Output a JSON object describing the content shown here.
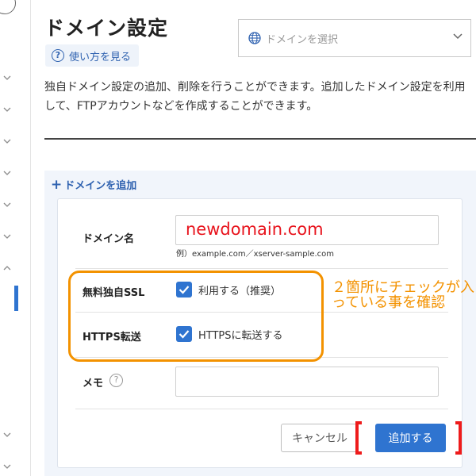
{
  "header": {
    "title": "ドメイン設定",
    "help_label": "使い方を見る",
    "domain_select_placeholder": "ドメインを選択"
  },
  "description": "独自ドメイン設定の追加、削除を行うことができます。追加したドメイン設定を利用して、FTPアカウントなどを作成することができます。",
  "add_panel": {
    "add_link_label": "ドメインを追加",
    "domain_label": "ドメイン名",
    "domain_value": "newdomain.com",
    "domain_example": "例）example.com／xserver-sample.com",
    "ssl_label": "無料独自SSL",
    "ssl_option": "利用する（推奨）",
    "https_label": "HTTPS転送",
    "https_option": "HTTPSに転送する",
    "memo_label": "メモ",
    "memo_value": "",
    "cancel_label": "キャンセル",
    "submit_label": "追加する"
  },
  "annotation": {
    "note": "２箇所にチェックが入っている事を確認"
  },
  "colors": {
    "accent_blue": "#2f74d0",
    "annotation_orange": "#f39200",
    "annotation_red": "#e8131c"
  }
}
